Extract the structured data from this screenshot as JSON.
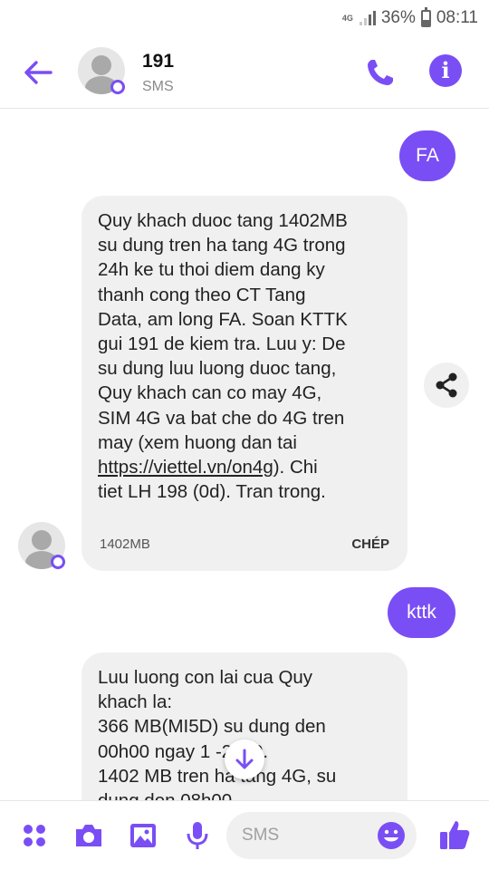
{
  "status_bar": {
    "network": "4G",
    "battery": "36%",
    "time": "08:11",
    "battery_level": 0.36
  },
  "header": {
    "contact_name": "191",
    "contact_sub": "SMS"
  },
  "thread": {
    "messages": [
      {
        "direction": "outgoing",
        "text": "FA"
      },
      {
        "direction": "incoming",
        "text_before_link": "Quy khach duoc tang 1402MB\nsu dung tren ha tang 4G trong\n24h ke tu thoi diem dang ky\nthanh cong theo CT Tang\nData, am long FA. Soan KTTK\ngui 191 de kiem tra. Luu y: De\nsu dung luu luong duoc tang,\nQuy khach can co may 4G,\nSIM 4G va bat che do 4G tren\nmay (xem huong dan tai\n",
        "link": "https://viettel.vn/on4g",
        "text_after_link": "). Chi\ntiet LH 198 (0d). Tran trong.",
        "meta": "1402MB",
        "copy_label": "CHÉP"
      },
      {
        "direction": "outgoing",
        "text": "kttk"
      },
      {
        "direction": "incoming",
        "text": "Luu luong con lai cua Quy\nkhach la:\n366 MB(MI5D) su dung den\n00h00 ngay 1   -2020.\n1402 MB tren ha tang 4G, su\ndung den 08h00"
      }
    ]
  },
  "composer": {
    "placeholder": "SMS"
  },
  "colors": {
    "accent": "#7a4ef5",
    "bubble_incoming": "#f0f0f0"
  }
}
